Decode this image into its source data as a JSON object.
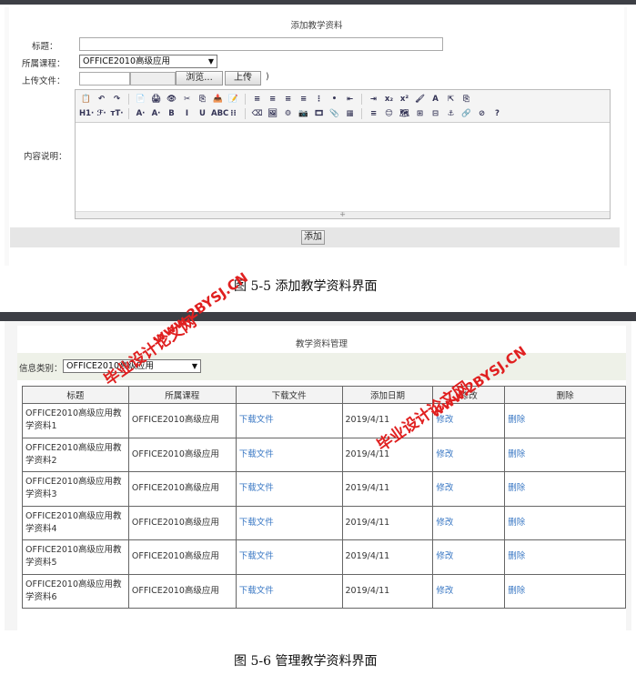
{
  "add_form": {
    "title": "添加教学资料",
    "label_title": "标题：",
    "label_course": "所属课程：",
    "course_value": "OFFICE2010高级应用",
    "label_upload": "上传文件：",
    "browse_label": "浏览...",
    "upload_label": "上传",
    "paren": ")",
    "label_content": "内容说明：",
    "submit_label": "添加",
    "toolbar_row1": [
      "📋",
      "↶",
      "↷",
      "📄",
      "🖨",
      "👁",
      "✂",
      "⎘",
      "📥",
      "📝",
      "≡",
      "≡",
      "≡",
      "≡",
      "⋮",
      "•",
      "⇤",
      "⇥",
      "x₂",
      "x²",
      "🖌",
      "A",
      "⇱",
      "⎘"
    ],
    "toolbar_row2": [
      "H1·",
      "ℱ·",
      "тT·",
      "A·",
      "A·",
      "B",
      "I",
      "U",
      "ABC",
      "⁝⁝",
      "⌫",
      "🖼",
      "⚙",
      "📷",
      "🎞",
      "📎",
      "▦",
      "≡",
      "😊",
      "🗺",
      "⊞",
      "⊟",
      "⚓",
      "🔗",
      "⊘",
      "?"
    ]
  },
  "caption_1": "图 5-5 添加教学资料界面",
  "manage": {
    "title": "教学资料管理",
    "filter_label": "信息类别：",
    "filter_value": "OFFICE2010高级应用",
    "headers": [
      "标题",
      "所属课程",
      "下载文件",
      "添加日期",
      "修改",
      "删除"
    ],
    "rows": [
      {
        "title": "OFFICE2010高级应用教学资料1",
        "course": "OFFICE2010高级应用",
        "download": "下载文件",
        "date": "2019/4/11",
        "edit": "修改",
        "delete": "删除"
      },
      {
        "title": "OFFICE2010高级应用教学资料2",
        "course": "OFFICE2010高级应用",
        "download": "下载文件",
        "date": "2019/4/11",
        "edit": "修改",
        "delete": "删除"
      },
      {
        "title": "OFFICE2010高级应用教学资料3",
        "course": "OFFICE2010高级应用",
        "download": "下载文件",
        "date": "2019/4/11",
        "edit": "修改",
        "delete": "删除"
      },
      {
        "title": "OFFICE2010高级应用教学资料4",
        "course": "OFFICE2010高级应用",
        "download": "下载文件",
        "date": "2019/4/11",
        "edit": "修改",
        "delete": "删除"
      },
      {
        "title": "OFFICE2010高级应用教学资料5",
        "course": "OFFICE2010高级应用",
        "download": "下载文件",
        "date": "2019/4/11",
        "edit": "修改",
        "delete": "删除"
      },
      {
        "title": "OFFICE2010高级应用教学资料6",
        "course": "OFFICE2010高级应用",
        "download": "下载文件",
        "date": "2019/4/11",
        "edit": "修改",
        "delete": "删除"
      }
    ]
  },
  "caption_2": "图 5-6 管理教学资料界面",
  "watermark": {
    "line1": "毕业设计论文网",
    "line2": "www.2BYSJ.CN"
  }
}
